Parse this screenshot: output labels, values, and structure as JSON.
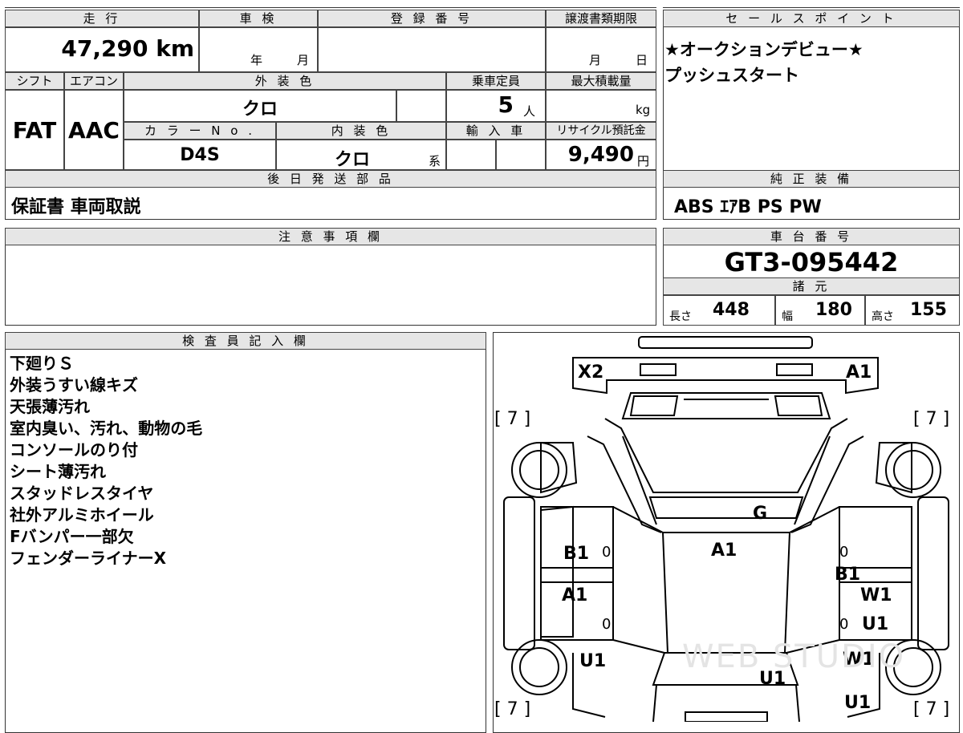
{
  "top": {
    "mileage_label": "走 行",
    "mileage_value": "47,290 km",
    "inspection_label": "車 検",
    "inspection_year": "年",
    "inspection_month": "月",
    "registration_label": "登 録 番 号",
    "transfer_label": "譲渡書類期限",
    "transfer_month": "月",
    "transfer_day": "日"
  },
  "specs": {
    "shift_label": "シフト",
    "shift_value": "FAT",
    "ac_label": "エアコン",
    "ac_value": "AAC",
    "exterior_label": "外 装 色",
    "exterior_value": "クロ",
    "capacity_label": "乗車定員",
    "capacity_value": "5",
    "capacity_unit": "人",
    "maxload_label": "最大積載量",
    "maxload_unit": "kg",
    "color_no_label": "カ ラ ー N o .",
    "color_no_value": "D4S",
    "interior_label": "内 装 色",
    "interior_value": "クロ",
    "interior_suffix": "系",
    "import_label": "輸 入 車",
    "recycle_label": "リサイクル預託金",
    "recycle_value": "9,490",
    "recycle_unit": "円"
  },
  "later_parts": {
    "label": "後 日 発 送 部 品",
    "value": "保証書 車両取説"
  },
  "sales_point": {
    "label": "セ ー ル ス ポ イ ン ト",
    "lines": [
      "★オークションデビュー★",
      "プッシュスタート"
    ]
  },
  "equipment": {
    "label": "純 正 装 備",
    "value": "ABS ｴｱB PS PW"
  },
  "caution": {
    "label": "注 意 事 項 欄"
  },
  "chassis": {
    "label": "車 台 番 号",
    "value": "GT3-095442",
    "dims_label": "諸 元",
    "length_label": "長さ",
    "length_value": "448",
    "width_label": "幅",
    "width_value": "180",
    "height_label": "高さ",
    "height_value": "155"
  },
  "inspector": {
    "label": "検 査 員 記 入 欄",
    "notes": [
      "下廻りＳ",
      "外装うすい線キズ",
      "天張薄汚れ",
      "室内臭い、汚れ、動物の毛",
      "コンソールのり付",
      "シート薄汚れ",
      "スタッドレスタイヤ",
      "社外アルミホイール",
      "Fバンパー一部欠",
      "フェンダーライナーX"
    ]
  },
  "diagram": {
    "labels": {
      "x2": "X2",
      "a1_front_right": "A1",
      "tire_fl": "[ 7 ]",
      "tire_fr": "[ 7 ]",
      "tire_rl": "[ 7 ]",
      "tire_rr": "[ 7 ]",
      "g": "G",
      "a1_roof": "A1",
      "b1_left": "B1",
      "b1_right": "B1",
      "a1_left_door": "A1",
      "w1_right_door": "W1",
      "u1_right_door": "U1",
      "u1_left_rear": "U1",
      "w1_right_rear": "W1",
      "u1_rear_center": "U1",
      "u1_right_bottom": "U1",
      "zero1": "0",
      "zero2": "0",
      "zero3": "0",
      "zero4": "0"
    },
    "watermark": "WEB STUDIO"
  }
}
